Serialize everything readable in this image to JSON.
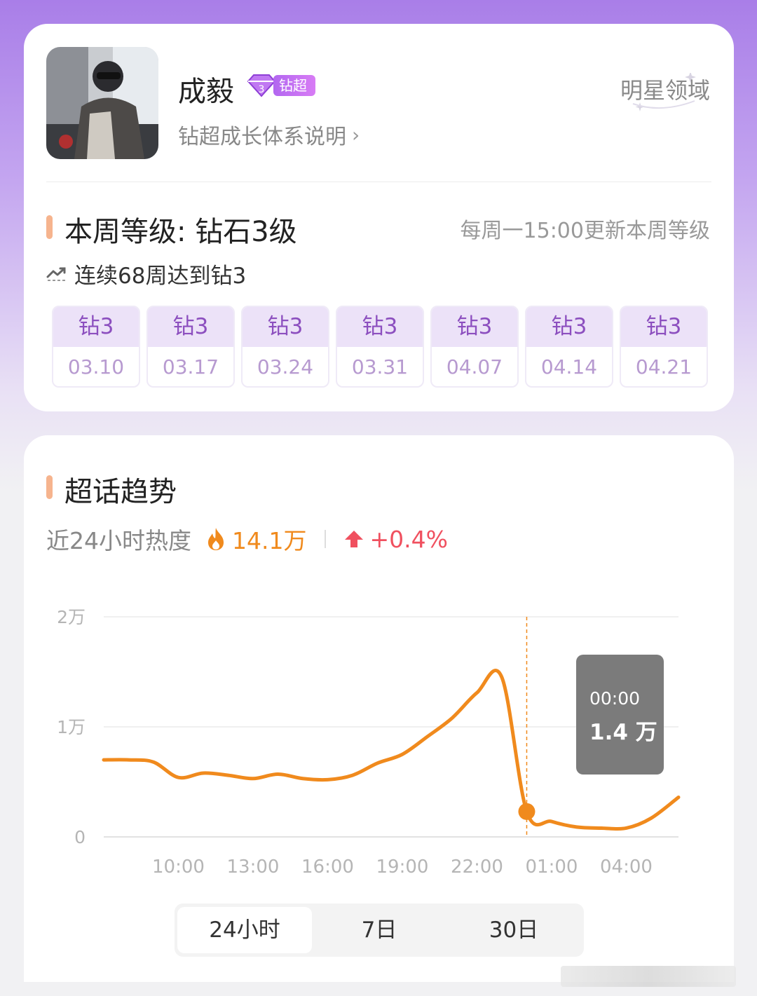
{
  "profile": {
    "name": "成毅",
    "badge_label": "钻超",
    "growth_link": "钻超成长体系说明",
    "domain_label": "明星领域"
  },
  "level": {
    "title": "本周等级: 钻石3级",
    "update_note": "每周一15:00更新本周等级",
    "streak": "连续68周达到钻3",
    "weeks": [
      {
        "level": "钻3",
        "date": "03.10"
      },
      {
        "level": "钻3",
        "date": "03.17"
      },
      {
        "level": "钻3",
        "date": "03.24"
      },
      {
        "level": "钻3",
        "date": "03.31"
      },
      {
        "level": "钻3",
        "date": "04.07"
      },
      {
        "level": "钻3",
        "date": "04.14"
      },
      {
        "level": "钻3",
        "date": "04.21"
      }
    ]
  },
  "trend": {
    "title": "超话趋势",
    "heat_label": "近24小时热度",
    "heat_value": "14.1万",
    "heat_change": "+0.4%",
    "tabs": [
      "24小时",
      "7日",
      "30日"
    ],
    "active_tab": "24小时",
    "tooltip": {
      "time": "00:00",
      "value": "1.4 万"
    }
  },
  "colors": {
    "accent_orange": "#f08a1d",
    "change_red": "#f0505f",
    "section_bar": "#f6b48e",
    "level_purple": "#8c4fbf"
  },
  "chart_data": {
    "type": "line",
    "x_tick_labels": [
      "10:00",
      "13:00",
      "16:00",
      "19:00",
      "22:00",
      "01:00",
      "04:00"
    ],
    "y_tick_labels": [
      "0",
      "1万",
      "2万"
    ],
    "ylim": [
      0,
      20000
    ],
    "grid": true,
    "x_hours": [
      7,
      8,
      9,
      10,
      11,
      12,
      13,
      14,
      15,
      16,
      17,
      18,
      19,
      20,
      21,
      22,
      23,
      24,
      25,
      26,
      27,
      28,
      29,
      30.1
    ],
    "values": [
      7000,
      7000,
      6800,
      5400,
      5800,
      5600,
      5300,
      5700,
      5300,
      5200,
      5600,
      6700,
      7500,
      9100,
      10800,
      13100,
      14500,
      2300,
      1400,
      900,
      800,
      800,
      1700,
      3600
    ],
    "highlight": {
      "x_hour": 24,
      "label": "00:00",
      "value": "1.4 万"
    }
  }
}
